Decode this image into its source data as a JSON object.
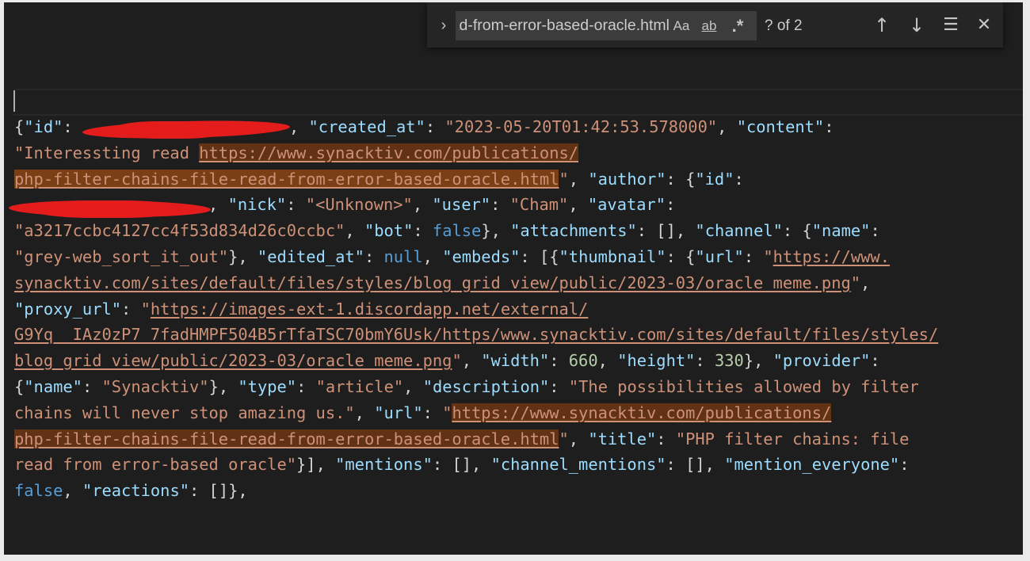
{
  "find_widget": {
    "query": "php-filter-chains-file-read-from-error-based-oracle.html",
    "toggle_icon": "›",
    "match_case_label": "Aa",
    "whole_word_label": "ab",
    "regex_label": ".*",
    "match_count": "? of 2",
    "prev_icon": "↑",
    "next_icon": "↓",
    "selection_icon": "☰",
    "close_icon": "✕"
  },
  "code": {
    "l1": {
      "a": "{",
      "b": "\"id\"",
      "c": ": ",
      "d": "",
      "e": ", ",
      "f": "\"created_at\"",
      "g": ": ",
      "h": "\"2023-05-20T01:42:53.578000\"",
      "i": ", ",
      "j": "\"content\"",
      "k": ":"
    },
    "l2": {
      "a": "\"Interessting read ",
      "b": "https://www.synacktiv.com/publications/"
    },
    "l3": {
      "a": "php-filter-chains-file-read-from-error-based-oracle.html",
      "b": "\"",
      "c": ", ",
      "d": "\"author\"",
      "e": ": {",
      "f": "\"id\"",
      "g": ":"
    },
    "l4": {
      "a": "",
      "b": ", ",
      "c": "\"nick\"",
      "d": ": ",
      "e": "\"<Unknown>\"",
      "f": ", ",
      "g": "\"user\"",
      "h": ": ",
      "i": "\"Cham\"",
      "j": ", ",
      "k": "\"avatar\"",
      "l": ":"
    },
    "l5": {
      "a": "\"a3217ccbc4127cc4f53d834d26c0ccbc\"",
      "b": ", ",
      "c": "\"bot\"",
      "d": ": ",
      "e": "false",
      "f": "}, ",
      "g": "\"attachments\"",
      "h": ": [], ",
      "i": "\"channel\"",
      "j": ": {",
      "k": "\"name\"",
      "l": ":"
    },
    "l6": {
      "a": "\"grey-web_sort_it_out\"",
      "b": "}, ",
      "c": "\"edited_at\"",
      "d": ": ",
      "e": "null",
      "f": ", ",
      "g": "\"embeds\"",
      "h": ": [{",
      "i": "\"thumbnail\"",
      "j": ": {",
      "k": "\"url\"",
      "l": ": ",
      "m": "\"",
      "n": "https://www."
    },
    "l7": {
      "a": "synacktiv.com/sites/default/files/styles/blog_grid_view/public/2023-03/oracle_meme.png",
      "b": "\"",
      "c": ","
    },
    "l8": {
      "a": "\"proxy_url\"",
      "b": ": ",
      "c": "\"",
      "d": "https://images-ext-1.discordapp.net/external/"
    },
    "l9": {
      "a": "G9Yq__IAz0zP7_7fadHMPF504B5rTfaTSC70bmY6Usk/https/www.synacktiv.com/sites/default/files/styles/"
    },
    "l10": {
      "a": "blog_grid_view/public/2023-03/oracle_meme.png",
      "b": "\"",
      "c": ", ",
      "d": "\"width\"",
      "e": ": ",
      "f": "660",
      "g": ", ",
      "h": "\"height\"",
      "i": ": ",
      "j": "330",
      "k": "}, ",
      "l": "\"provider\"",
      "m": ":"
    },
    "l11": {
      "a": "{",
      "b": "\"name\"",
      "c": ": ",
      "d": "\"Synacktiv\"",
      "e": "}, ",
      "f": "\"type\"",
      "g": ": ",
      "h": "\"article\"",
      "i": ", ",
      "j": "\"description\"",
      "k": ": ",
      "l": "\"The possibilities allowed by filter"
    },
    "l12": {
      "a": "chains will never stop amazing us.\"",
      "b": ", ",
      "c": "\"url\"",
      "d": ": ",
      "e": "\"",
      "f": "https://www.synacktiv.com/publications/"
    },
    "l13": {
      "a": "php-filter-chains-file-read-from-error-based-oracle.html",
      "b": "\"",
      "c": ", ",
      "d": "\"title\"",
      "e": ": ",
      "f": "\"PHP filter chains: file"
    },
    "l14": {
      "a": "read from error-based oracle\"",
      "b": "}], ",
      "c": "\"mentions\"",
      "d": ": [], ",
      "e": "\"channel_mentions\"",
      "f": ": [], ",
      "g": "\"mention_everyone\"",
      "h": ":"
    },
    "l15": {
      "a": "false",
      "b": ", ",
      "c": "\"reactions\"",
      "d": ": []},",
      "e": ""
    }
  },
  "colors": {
    "editor_bg": "#1e1e1e",
    "key": "#9cdcfe",
    "string": "#ce9178",
    "number": "#b5cea8",
    "keyword": "#569cd6",
    "find_match_highlight": "#613214",
    "redaction": "#e51c1c"
  }
}
